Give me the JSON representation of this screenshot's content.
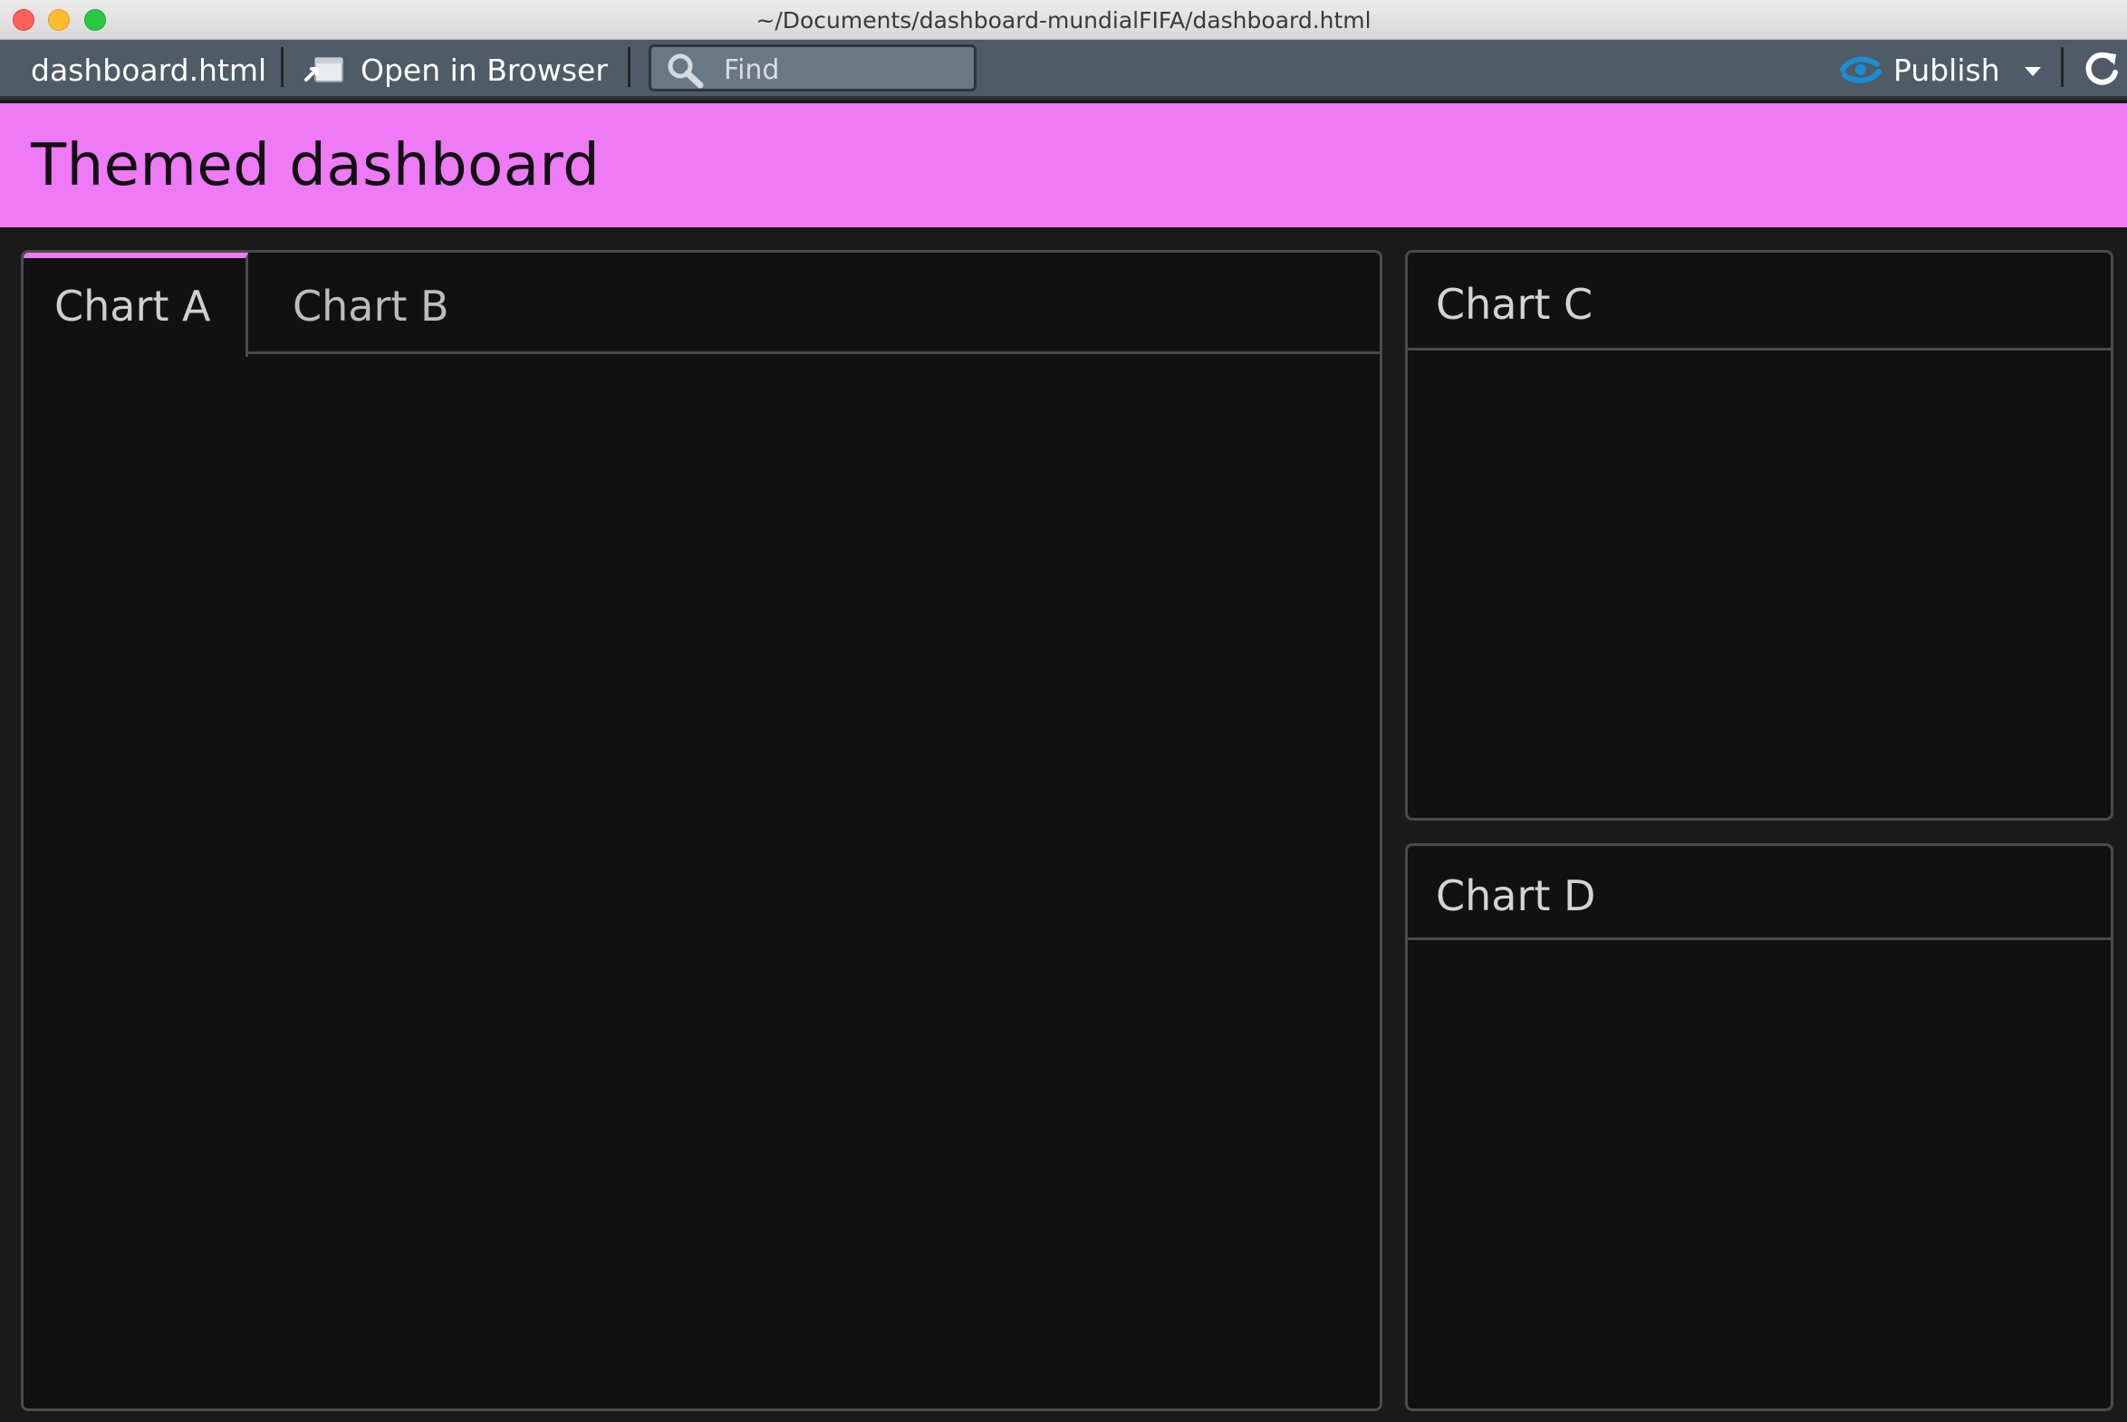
{
  "window": {
    "title": "~/Documents/dashboard-mundialFIFA/dashboard.html"
  },
  "toolbar": {
    "file_label": "dashboard.html",
    "open_browser_label": "Open in Browser",
    "find_placeholder": "Find",
    "publish_label": "Publish",
    "icons": [
      "browser-icon",
      "search-icon",
      "publish-icon",
      "chevron-down-icon",
      "refresh-icon"
    ]
  },
  "dashboard": {
    "title": "Themed dashboard",
    "header_color": "#ee7af5",
    "tabs": [
      {
        "label": "Chart A",
        "active": true
      },
      {
        "label": "Chart B",
        "active": false
      }
    ],
    "cards": [
      {
        "title": "Chart C"
      },
      {
        "title": "Chart D"
      }
    ]
  },
  "colors": {
    "accent": "#ee7af5",
    "toolbar_bg": "#4f5b66",
    "panel_bg": "#111111",
    "page_bg": "#1a1a1a",
    "publish_icon": "#1a8fd6"
  }
}
